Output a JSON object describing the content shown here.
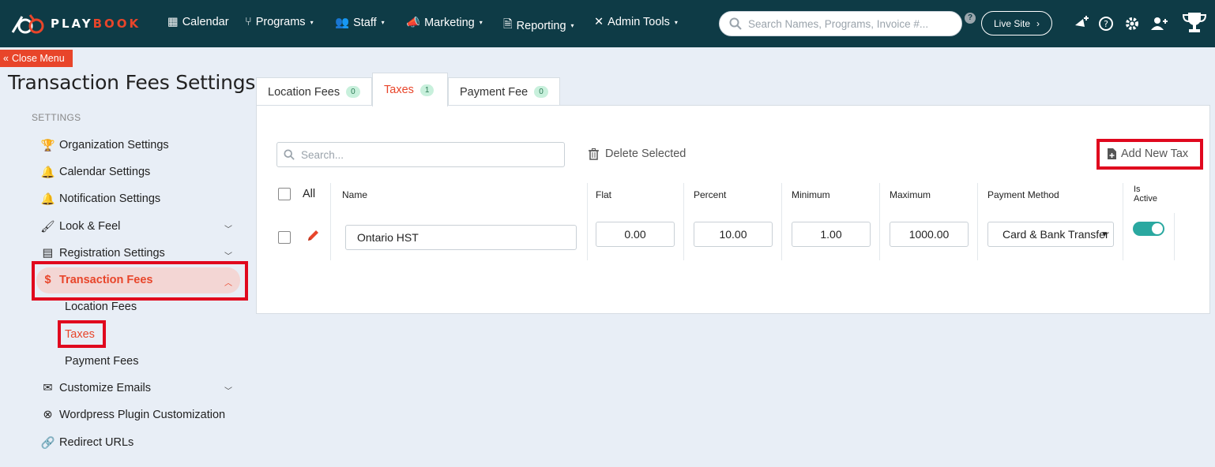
{
  "brand": {
    "logo_text_part1": "PLAY",
    "logo_text_part2": "BOOK"
  },
  "nav": {
    "items": [
      {
        "label": "Calendar",
        "icon": "calendar-icon",
        "has_caret": false
      },
      {
        "label": "Programs",
        "icon": "branch-icon",
        "has_caret": true
      },
      {
        "label": "Staff",
        "icon": "users-icon",
        "has_caret": true
      },
      {
        "label": "Marketing",
        "icon": "megaphone-icon",
        "has_caret": true
      },
      {
        "label": "Reporting",
        "icon": "document-icon",
        "has_caret": true
      },
      {
        "label": "Admin Tools",
        "icon": "tools-icon",
        "has_caret": true
      }
    ],
    "search_placeholder": "Search Names, Programs, Invoice #...",
    "live_site_label": "Live Site"
  },
  "close_menu_label": "Close Menu",
  "page_title": "Transaction Fees Settings",
  "sidebar": {
    "section_label": "SETTINGS",
    "items": [
      {
        "label": "Organization Settings",
        "icon": "trophy-icon"
      },
      {
        "label": "Calendar Settings",
        "icon": "bell-icon"
      },
      {
        "label": "Notification Settings",
        "icon": "bell-icon"
      },
      {
        "label": "Look & Feel",
        "icon": "brush-icon"
      },
      {
        "label": "Registration Settings",
        "icon": "form-icon"
      },
      {
        "label": "Transaction Fees",
        "icon": "dollar-icon"
      },
      {
        "label": "Customize Emails",
        "icon": "envelope-icon"
      },
      {
        "label": "Wordpress Plugin Customization",
        "icon": "wordpress-icon"
      },
      {
        "label": "Redirect URLs",
        "icon": "link-icon"
      }
    ],
    "sub_items": [
      "Location Fees",
      "Taxes",
      "Payment Fees"
    ],
    "active_sub": "Taxes"
  },
  "tabs": [
    {
      "label": "Location Fees",
      "count": "0"
    },
    {
      "label": "Taxes",
      "count": "1"
    },
    {
      "label": "Payment Fee",
      "count": "0"
    }
  ],
  "toolbar": {
    "search_placeholder": "Search...",
    "delete_label": "Delete Selected",
    "add_label": "Add New Tax"
  },
  "table": {
    "headers": {
      "all": "All",
      "name": "Name",
      "flat": "Flat",
      "percent": "Percent",
      "minimum": "Minimum",
      "maximum": "Maximum",
      "payment_method": "Payment Method",
      "is_active_1": "Is",
      "is_active_2": "Active"
    },
    "rows": [
      {
        "name": "Ontario HST",
        "flat": "0.00",
        "percent": "10.00",
        "minimum": "1.00",
        "maximum": "1000.00",
        "payment_method": "Card & Bank Transfer",
        "is_active": true
      }
    ]
  },
  "colors": {
    "nav_bg": "#0e3b46",
    "accent": "#e8452a",
    "highlight_box": "#e0081e",
    "toggle_on": "#2aa8a0"
  }
}
